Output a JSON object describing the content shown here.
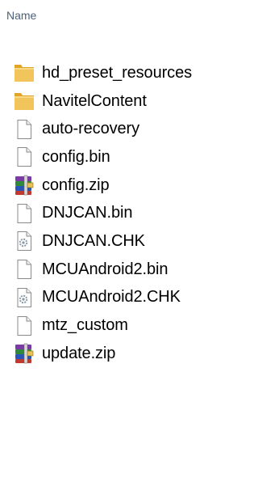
{
  "header": {
    "name_label": "Name"
  },
  "files": [
    {
      "name": "hd_preset_resources",
      "icon": "folder-icon"
    },
    {
      "name": "NavitelContent",
      "icon": "folder-icon"
    },
    {
      "name": "auto-recovery",
      "icon": "file-icon"
    },
    {
      "name": "config.bin",
      "icon": "file-icon"
    },
    {
      "name": "config.zip",
      "icon": "archive-icon"
    },
    {
      "name": "DNJCAN.bin",
      "icon": "file-icon"
    },
    {
      "name": "DNJCAN.CHK",
      "icon": "system-file-icon"
    },
    {
      "name": "MCUAndroid2.bin",
      "icon": "file-icon"
    },
    {
      "name": "MCUAndroid2.CHK",
      "icon": "system-file-icon"
    },
    {
      "name": "mtz_custom",
      "icon": "file-icon"
    },
    {
      "name": "update.zip",
      "icon": "archive-icon"
    }
  ],
  "colors": {
    "header_text": "#4c607a",
    "folder": "#f2c55c",
    "folder_dark": "#e0a526"
  }
}
